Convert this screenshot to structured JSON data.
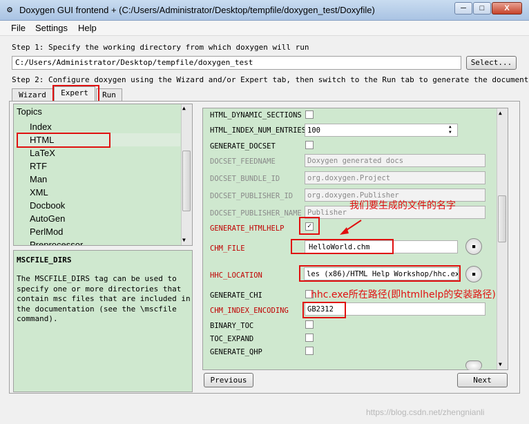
{
  "window": {
    "title": "Doxygen GUI frontend + (C:/Users/Administrator/Desktop/tempfile/doxygen_test/Doxyfile)",
    "minimize": "─",
    "maximize": "□",
    "close": "X"
  },
  "menu": [
    "File",
    "Settings",
    "Help"
  ],
  "step1": {
    "text": "Step 1: Specify the working directory from which doxygen will run",
    "path": "C:/Users/Administrator/Desktop/tempfile/doxygen_test",
    "select_label": "Select..."
  },
  "step2": {
    "text": "Step 2: Configure doxygen using the Wizard and/or Expert tab, then switch to the Run tab to generate the documentation"
  },
  "tabs": [
    "Wizard",
    "Expert",
    "Run"
  ],
  "topics": {
    "header": "Topics",
    "items": [
      "Index",
      "HTML",
      "LaTeX",
      "RTF",
      "Man",
      "XML",
      "Docbook",
      "AutoGen",
      "PerlMod",
      "Preprocessor"
    ],
    "selected": "HTML"
  },
  "help": {
    "title": "MSCFILE_DIRS",
    "body": "The MSCFILE_DIRS tag can be used to\nspecify one or more directories that\ncontain msc files that are included in\nthe documentation (see the \\mscfile\ncommand)."
  },
  "options": {
    "html_dynamic_sections": {
      "label": "HTML_DYNAMIC_SECTIONS",
      "checked": false
    },
    "html_index_num_entries": {
      "label": "HTML_INDEX_NUM_ENTRIES",
      "value": "100"
    },
    "generate_docset": {
      "label": "GENERATE_DOCSET",
      "checked": false
    },
    "docset_feedname": {
      "label": "DOCSET_FEEDNAME",
      "value": "Doxygen generated docs"
    },
    "docset_bundle_id": {
      "label": "DOCSET_BUNDLE_ID",
      "value": "org.doxygen.Project"
    },
    "docset_publisher_id": {
      "label": "DOCSET_PUBLISHER_ID",
      "value": "org.doxygen.Publisher"
    },
    "docset_publisher_name": {
      "label": "DOCSET_PUBLISHER_NAME",
      "value": "Publisher"
    },
    "generate_htmlhelp": {
      "label": "GENERATE_HTMLHELP",
      "checked": true
    },
    "chm_file": {
      "label": "CHM_FILE",
      "value": "HelloWorld.chm"
    },
    "hhc_location": {
      "label": "HHC_LOCATION",
      "value": "les (x86)/HTML Help Workshop/hhc.exe"
    },
    "generate_chi": {
      "label": "GENERATE_CHI",
      "checked": false
    },
    "chm_index_encoding": {
      "label": "CHM_INDEX_ENCODING",
      "value": "GB2312"
    },
    "binary_toc": {
      "label": "BINARY_TOC",
      "checked": false
    },
    "toc_expand": {
      "label": "TOC_EXPAND",
      "checked": false
    },
    "generate_qhp": {
      "label": "GENERATE_QHP",
      "checked": false
    }
  },
  "annotations": {
    "chm_note": "我们要生成的文件的名字",
    "hhc_note": "hhc.exe所在路径(即htmlhelp的安装路径)"
  },
  "nav": {
    "previous": "Previous",
    "next": "Next"
  },
  "watermark": "https://blog.csdn.net/zhengnianli",
  "colors": {
    "panel_green": "#cfe8cf",
    "highlight_red": "#e01010",
    "required_label": "#c00000"
  }
}
